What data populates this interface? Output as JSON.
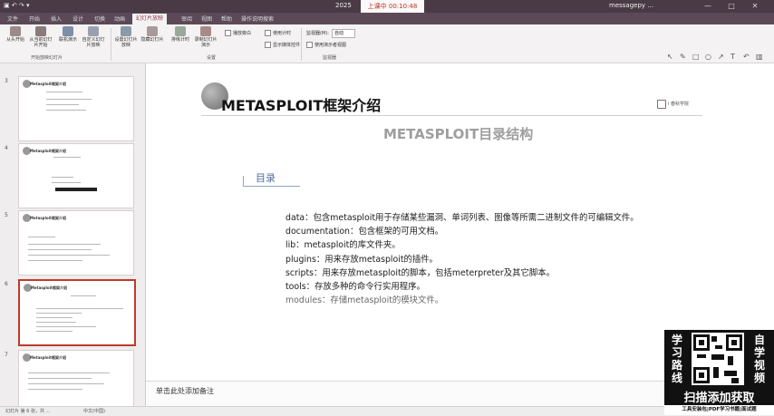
{
  "titlebar": {
    "doc_title": "2025",
    "recording": "上课中 00:10:48",
    "user": "messagepy ..."
  },
  "menu": {
    "tabs": [
      "文件",
      "开始",
      "插入",
      "设计",
      "切换",
      "动画",
      "幻灯片放映",
      "审阅",
      "视图",
      "帮助",
      "操作说明搜索"
    ],
    "active_index": 6
  },
  "ribbon": {
    "buttons": [
      {
        "label": "从头开始"
      },
      {
        "label": "从当前幻灯片开始"
      },
      {
        "label": "联机演示"
      },
      {
        "label": "自定义幻灯片放映"
      },
      {
        "label": "设置幻灯片放映"
      },
      {
        "label": "隐藏幻灯片"
      },
      {
        "label": "排练计时"
      },
      {
        "label": "录制幻灯片演示"
      }
    ],
    "checks": [
      "播放旁白",
      "使用计时",
      "显示媒体控件"
    ],
    "monitor_label": "监视器(M):",
    "monitor_value": "自动",
    "presenter_view": "使用演示者视图",
    "groups": [
      "开始放映幻灯片",
      "设置",
      "监视器"
    ]
  },
  "slides_panel": {
    "numbers": [
      "3",
      "4",
      "5",
      "6",
      "7"
    ],
    "thumb_titles": [
      "Metasploit框架介绍",
      "Metasploit框架介绍",
      "Metasploit框架介绍",
      "Metasploit框架介绍",
      "Metasploit框架介绍"
    ],
    "selected_index": 3
  },
  "slide": {
    "title": "METASPLOIT框架介绍",
    "subtitle": "METASPLOIT目录结构",
    "logo_text": "i 春秋学院",
    "section": "目录",
    "items": [
      "data：包含metasploit用于存储某些漏洞、单词列表、图像等所需二进制文件的可编辑文件。",
      "documentation：包含框架的可用文档。",
      "lib：metasploit的库文件夹。",
      "plugins：用来存放metasploit的插件。",
      "scripts：用来存放metasploit的脚本，包括meterpreter及其它脚本。",
      "tools：存放多种的命令行实用程序。",
      "modules：存储metasploit的模块文件。"
    ]
  },
  "notes": {
    "placeholder": "单击此处添加备注"
  },
  "status": {
    "slide_info": "幻灯片 第 6 张，共 ...",
    "language": "中文(中国)"
  },
  "watermark": {
    "left_chars": [
      "学",
      "习",
      "路",
      "线"
    ],
    "right_chars": [
      "自",
      "学",
      "视",
      "频"
    ],
    "cta": "扫描添加获取",
    "footer": "工具安装包|PDF学习书籍|面试题"
  },
  "colors": {
    "title_bar": "#4a3a46",
    "section_blue": "#4f6d9c",
    "selected_border": "#c0392b"
  }
}
